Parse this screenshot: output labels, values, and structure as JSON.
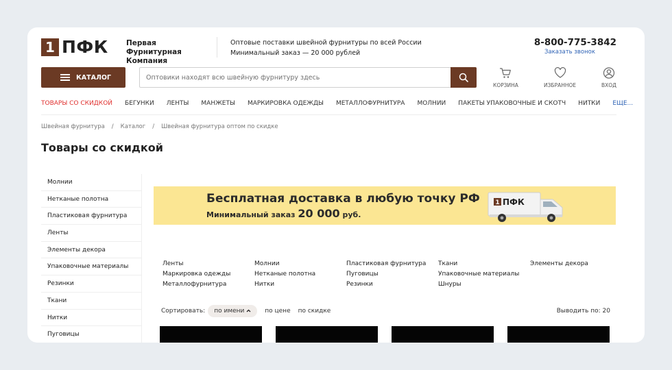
{
  "header": {
    "logo_box": "1",
    "logo_text": "ПФК",
    "company_line1": "Первая Фурнитурная",
    "company_line2": "Компания",
    "info_line1": "Оптовые поставки швейной фурнитуры по всей России",
    "info_line2": "Минимальный заказ — 20 000 рублей",
    "phone": "8-800-775-3842",
    "callback": "Заказать звонок"
  },
  "toolbar": {
    "catalog_label": "КАТАЛОГ",
    "search_placeholder": "Оптовики находят всю швейную фурнитуру здесь",
    "cart_label": "КОРЗИНА",
    "favorites_label": "ИЗБРАННОЕ",
    "login_label": "ВХОД"
  },
  "nav": [
    "ТОВАРЫ СО СКИДКОЙ",
    "БЕГУНКИ",
    "ЛЕНТЫ",
    "МАНЖЕТЫ",
    "МАРКИРОВКА ОДЕЖДЫ",
    "МЕТАЛЛОФУРНИТУРА",
    "МОЛНИИ",
    "ПАКЕТЫ УПАКОВОЧНЫЕ И СКОТЧ",
    "НИТКИ",
    "ЕЩЕ..."
  ],
  "breadcrumbs": [
    "Швейная фурнитура",
    "Каталог",
    "Швейная фурнитура оптом по скидке"
  ],
  "breadcrumb_sep": "/",
  "page_title": "Товары со скидкой",
  "sidebar": [
    "Молнии",
    "Нетканые полотна",
    "Пластиковая фурнитура",
    "Ленты",
    "Элементы декора",
    "Упаковочные материалы",
    "Резинки",
    "Ткани",
    "Нитки",
    "Пуговицы"
  ],
  "banner": {
    "line1": "Бесплатная доставка в любую точку РФ",
    "line2_prefix": "Минимальный заказ",
    "line2_amount": "20 000",
    "line2_suffix": "руб.",
    "truck_logo": "1ПФК"
  },
  "categories": [
    "Ленты",
    "Молнии",
    "Пластиковая фурнитура",
    "Ткани",
    "Элементы декора",
    "Маркировка одежды",
    "Нетканые полотна",
    "Пуговицы",
    "Упаковочные материалы",
    "",
    "Металлофурнитура",
    "Нитки",
    "Резинки",
    "Шнуры",
    ""
  ],
  "sort": {
    "label": "Сортировать:",
    "active": "по имени",
    "options": [
      "по цене",
      "по скидке"
    ],
    "per_page": "Выводить по: 20"
  },
  "colors": {
    "brand": "#6b3a24",
    "sale": "#e0312f",
    "link": "#2f63b5",
    "banner_bg": "#fbe693"
  }
}
